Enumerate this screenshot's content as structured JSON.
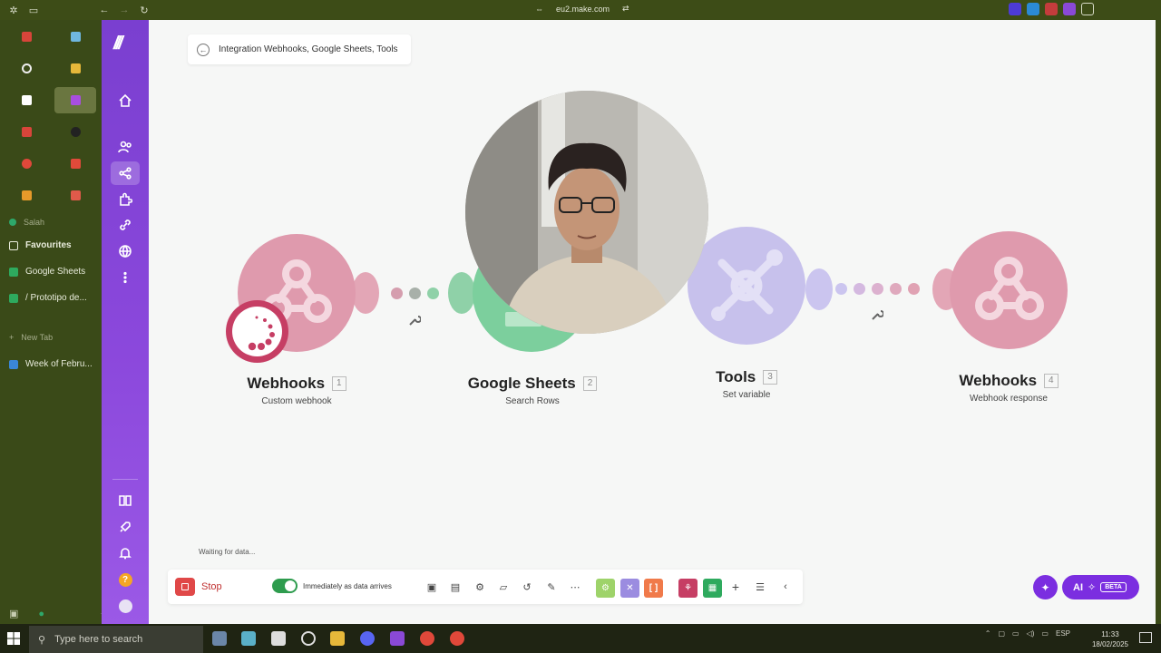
{
  "browser": {
    "url": "eu2.make.com",
    "profile_name": "Salah",
    "favourites_label": "Favourites",
    "tabs": [
      {
        "label": "Google Sheets"
      },
      {
        "label": "/ Prototipo de..."
      },
      {
        "label": "New Tab"
      },
      {
        "label": "Week of Febru..."
      }
    ]
  },
  "scenario": {
    "breadcrumb": "Integration Webhooks, Google Sheets, Tools",
    "status": "Waiting for data...",
    "modules": [
      {
        "name": "Webhooks",
        "num": "1",
        "sub": "Custom webhook",
        "color": "#df9aad"
      },
      {
        "name": "Google Sheets",
        "num": "2",
        "sub": "Search Rows",
        "color": "#7ccf9d"
      },
      {
        "name": "Tools",
        "num": "3",
        "sub": "Set variable",
        "color": "#c7c1ec"
      },
      {
        "name": "Webhooks",
        "num": "4",
        "sub": "Webhook response",
        "color": "#df9aad"
      }
    ]
  },
  "toolbar": {
    "stop_label": "Stop",
    "schedule_label": "Immediately as data arrives"
  },
  "ai": {
    "label": "AI",
    "badge": "BETA"
  },
  "taskbar": {
    "search_placeholder": "Type here to search",
    "lang": "ESP",
    "time": "11:33",
    "date": "18/02/2025"
  },
  "colors": {
    "make_purple": "#7a3fd0",
    "webhook_pink": "#df9aad",
    "sheets_green": "#7ccf9d",
    "tools_lavender": "#c7c1ec",
    "stop_red": "#e04848",
    "toggle_green": "#2e9c4e"
  }
}
